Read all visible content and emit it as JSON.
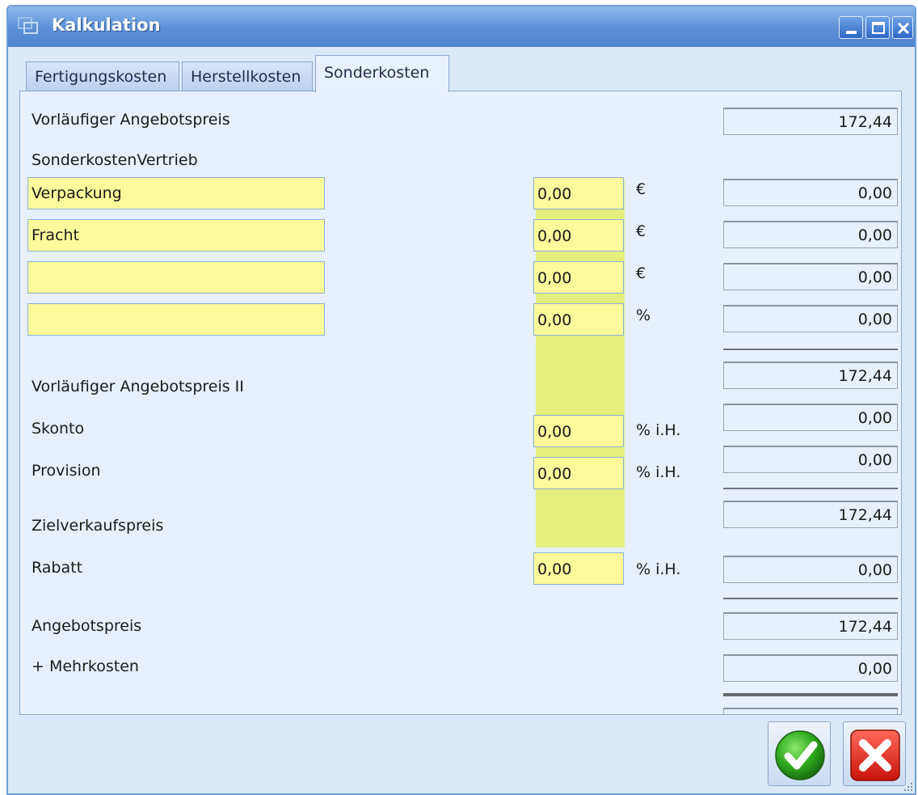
{
  "window": {
    "title": "Kalkulation"
  },
  "tabs": [
    {
      "label": "Fertigungskosten"
    },
    {
      "label": "Herstellkosten"
    },
    {
      "label": "Sonderkosten"
    }
  ],
  "form": {
    "vorl_angebotspreis": {
      "label": "Vorläufiger Angebotspreis",
      "result": "172,44"
    },
    "sonderkosten_vertrieb": {
      "label": "SonderkostenVertrieb",
      "rows": [
        {
          "name": "Verpackung",
          "value": "0,00",
          "unit": "€",
          "result": "0,00"
        },
        {
          "name": "Fracht",
          "value": "0,00",
          "unit": "€",
          "result": "0,00"
        },
        {
          "name": "",
          "value": "0,00",
          "unit": "€",
          "result": "0,00"
        },
        {
          "name": "",
          "value": "0,00",
          "unit": "%",
          "result": "0,00"
        }
      ]
    },
    "vorl_angebotspreis_2": {
      "label": "Vorläufiger Angebotspreis II",
      "result": "172,44"
    },
    "skonto": {
      "label": "Skonto",
      "value": "0,00",
      "unit": "% i.H.",
      "result": "0,00"
    },
    "provision": {
      "label": "Provision",
      "value": "0,00",
      "unit": "% i.H.",
      "result": "0,00"
    },
    "zielverkaufspreis": {
      "label": "Zielverkaufspreis",
      "result": "172,44"
    },
    "rabatt": {
      "label": "Rabatt",
      "value": "0,00",
      "unit": "% i.H.",
      "result": "0,00"
    },
    "angebotspreis": {
      "label": "Angebotspreis",
      "result": "172,44"
    },
    "mehrkosten": {
      "label": "+ Mehrkosten",
      "result": "0,00"
    }
  },
  "colors": {
    "field_yellow": "#fcfa9a",
    "column_highlight": "#e4ef7d",
    "panel_bg": "#e7f0fc",
    "title_blue": "#5b8fd6"
  },
  "icons": {
    "ok": "checkmark-icon",
    "cancel": "cross-icon",
    "minimize": "minimize-icon",
    "maximize": "maximize-icon",
    "close": "close-icon"
  }
}
